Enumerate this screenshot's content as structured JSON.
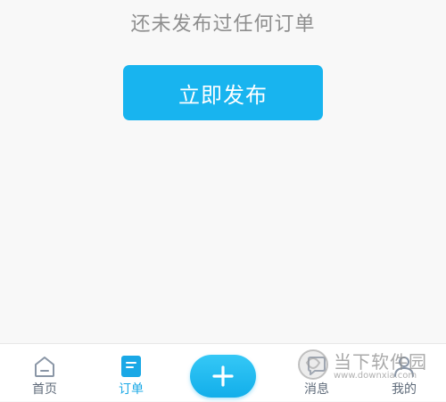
{
  "main": {
    "empty_message": "还未发布过任何订单",
    "publish_button_label": "立即发布"
  },
  "tabbar": {
    "tabs": [
      {
        "label": "首页",
        "icon": "home-icon",
        "active": false
      },
      {
        "label": "订单",
        "icon": "orders-icon",
        "active": true
      },
      {
        "label": "消息",
        "icon": "message-icon",
        "active": false
      },
      {
        "label": "我的",
        "icon": "user-icon",
        "active": false
      }
    ],
    "add_icon": "plus-icon"
  },
  "watermark": {
    "title": "当下软件园",
    "url": "www.downxia.com"
  },
  "colors": {
    "accent": "#18b4ef",
    "background": "#f8f8f8",
    "tab_inactive": "#5f6b7a",
    "tab_active": "#1aa8e6"
  }
}
